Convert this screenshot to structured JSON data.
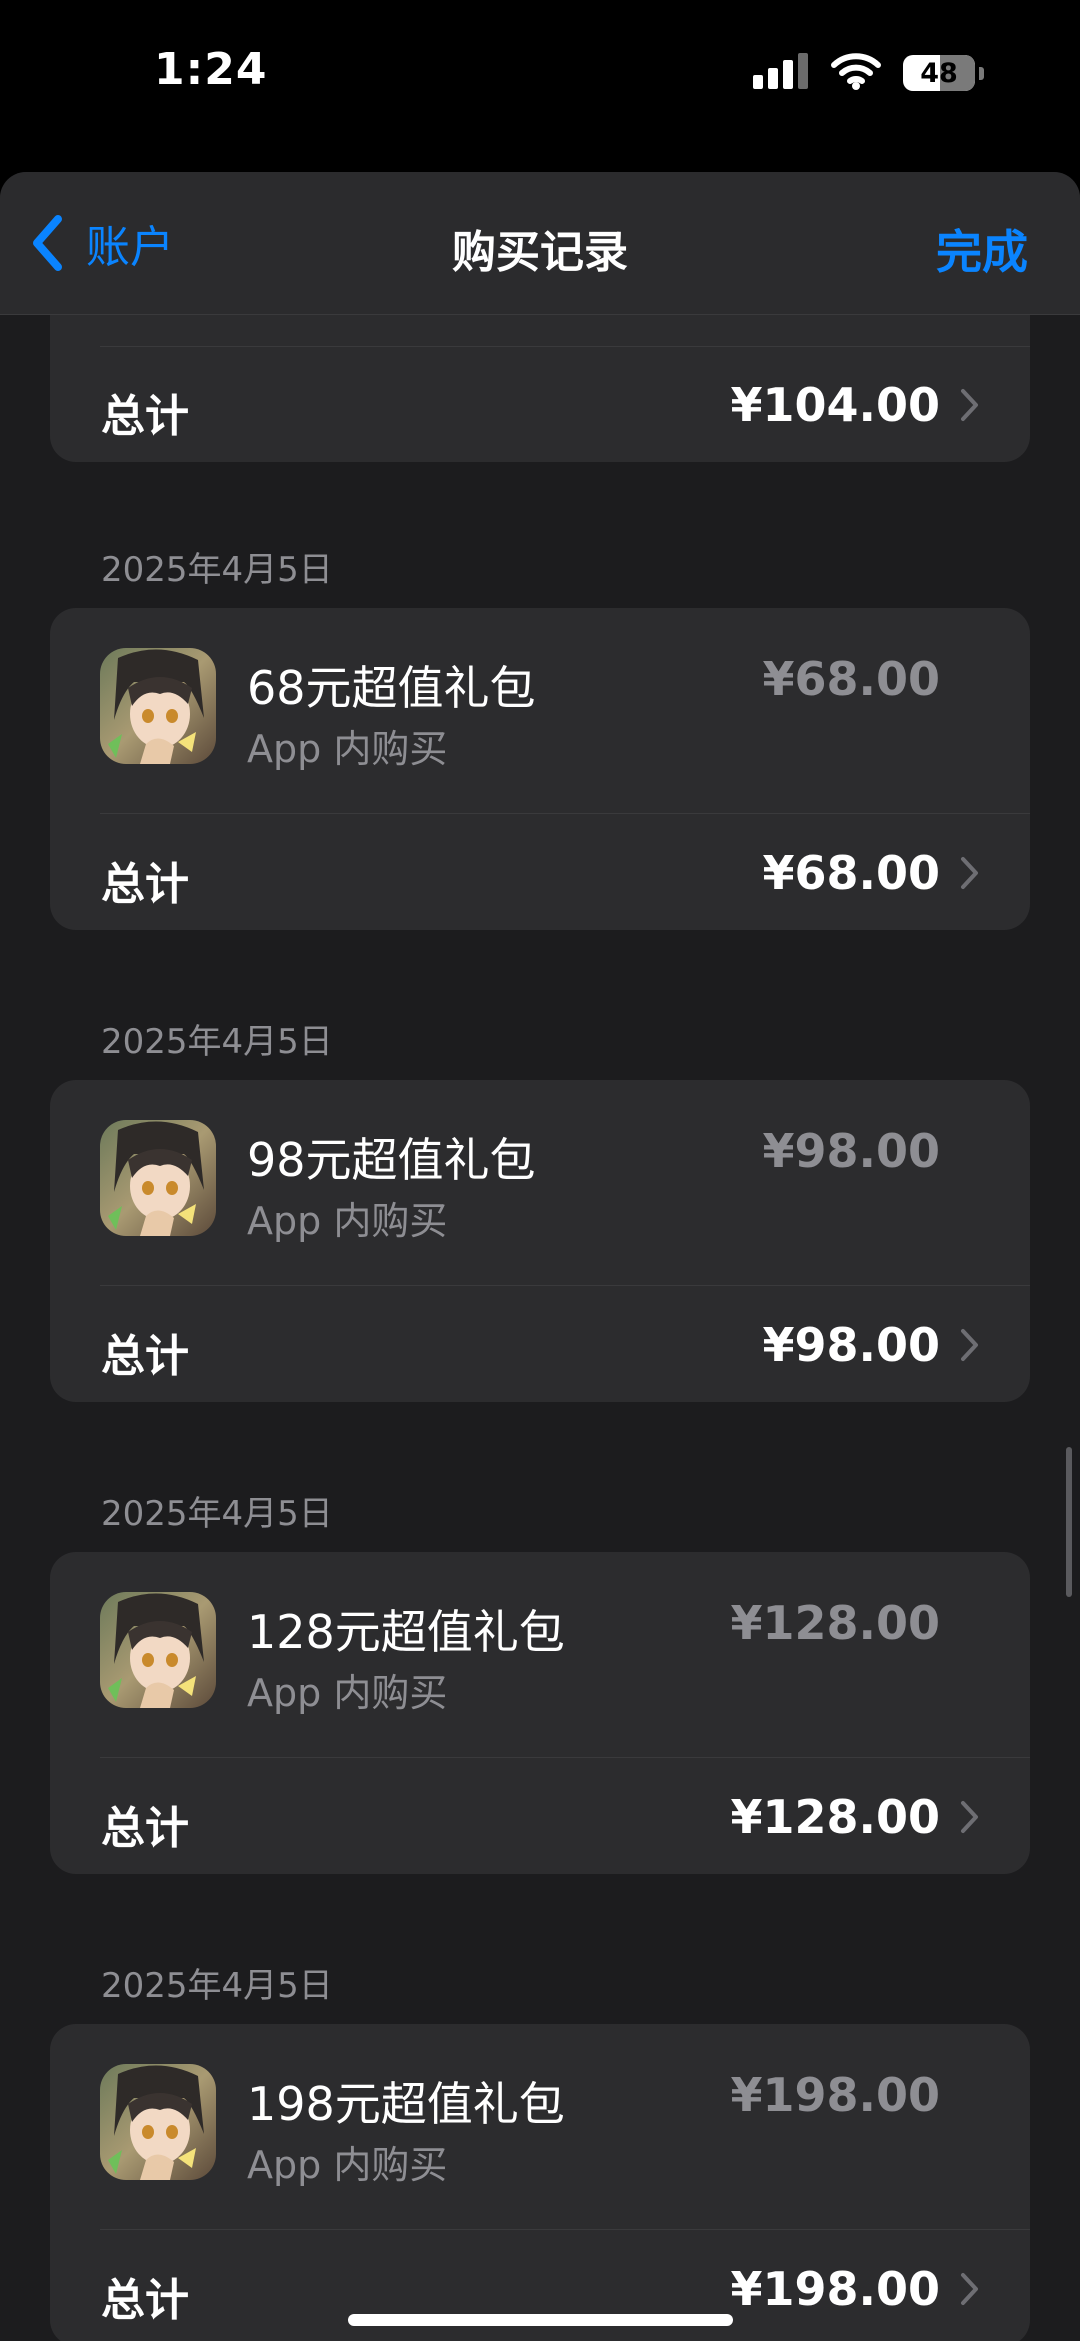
{
  "status_bar": {
    "time": "1:24",
    "battery": "48"
  },
  "nav": {
    "back_label": "账户",
    "title": "购买记录",
    "done_label": "完成"
  },
  "top_total": {
    "label": "总计",
    "value": "¥104.00"
  },
  "groups": [
    {
      "date": "2025年4月5日",
      "item_name": "68元超值礼包",
      "item_type": "App 内购买",
      "item_price": "¥68.00",
      "total_label": "总计",
      "total_value": "¥68.00"
    },
    {
      "date": "2025年4月5日",
      "item_name": "98元超值礼包",
      "item_type": "App 内购买",
      "item_price": "¥98.00",
      "total_label": "总计",
      "total_value": "¥98.00"
    },
    {
      "date": "2025年4月5日",
      "item_name": "128元超值礼包",
      "item_type": "App 内购买",
      "item_price": "¥128.00",
      "total_label": "总计",
      "total_value": "¥128.00"
    },
    {
      "date": "2025年4月5日",
      "item_name": "198元超值礼包",
      "item_type": "App 内购买",
      "item_price": "¥198.00",
      "total_label": "总计",
      "total_value": "¥198.00"
    }
  ],
  "colors": {
    "accent": "#0a84ff",
    "background": "#1c1c1e",
    "card": "#2c2c2e",
    "secondary_text": "#8e8e93"
  },
  "icons": {
    "back": "chevron-left-icon",
    "disclosure": "chevron-right-icon",
    "signal": "cellular-signal-icon",
    "wifi": "wifi-icon",
    "battery": "battery-icon",
    "app": "game-character-app-icon"
  }
}
